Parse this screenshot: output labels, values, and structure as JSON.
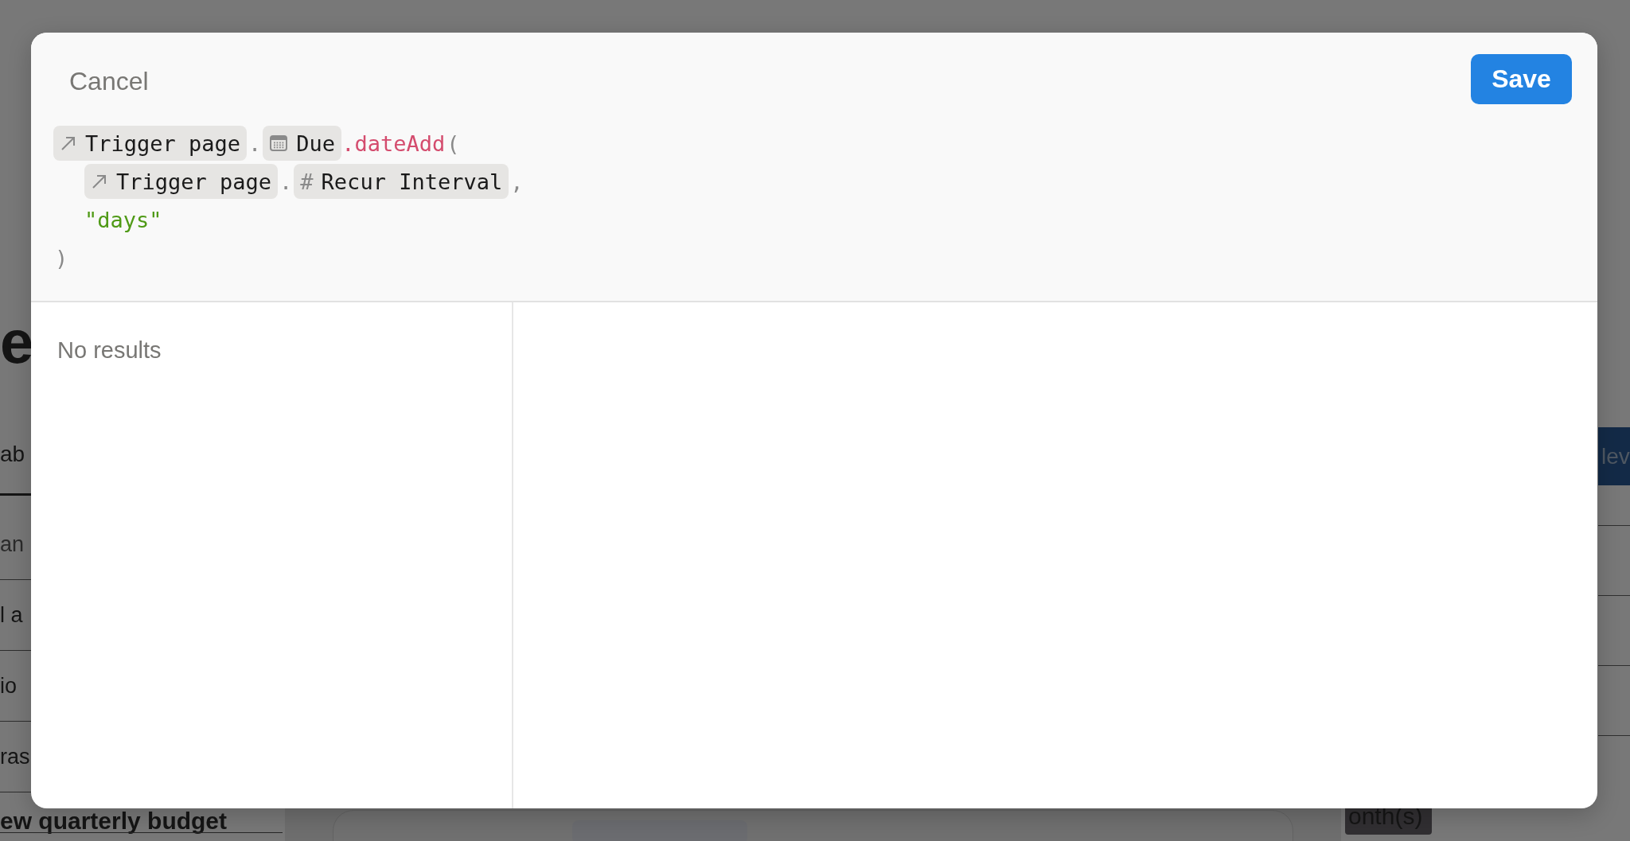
{
  "background_page": {
    "heading": "e",
    "tab": "ab",
    "rows": [
      {
        "text": "an",
        "muted": true
      },
      {
        "text": "l a",
        "muted": false
      },
      {
        "text": "io",
        "muted": false
      },
      {
        "text": "ras",
        "muted": false
      }
    ],
    "last_row": "ew quarterly budget",
    "button": "lev",
    "tag": "onth(s)"
  },
  "modal": {
    "cancel": "Cancel",
    "save": "Save",
    "formula": [
      {
        "nested": false,
        "tokens": [
          {
            "kind": "relation",
            "text": "Trigger page"
          },
          {
            "kind": "punct",
            "text": "."
          },
          {
            "kind": "date",
            "text": "Due"
          },
          {
            "kind": "function",
            "text": ".dateAdd"
          },
          {
            "kind": "punct",
            "text": "("
          }
        ]
      },
      {
        "nested": true,
        "tokens": [
          {
            "kind": "relation",
            "text": "Trigger page"
          },
          {
            "kind": "punct",
            "text": "."
          },
          {
            "kind": "number",
            "symbol": "#",
            "text": "Recur Interval"
          },
          {
            "kind": "punct",
            "text": ","
          }
        ]
      },
      {
        "nested": true,
        "tokens": [
          {
            "kind": "string",
            "text": "\"days\""
          }
        ]
      },
      {
        "nested": false,
        "tokens": [
          {
            "kind": "punct",
            "text": ")"
          }
        ]
      }
    ],
    "results": {
      "message": "No results"
    }
  }
}
